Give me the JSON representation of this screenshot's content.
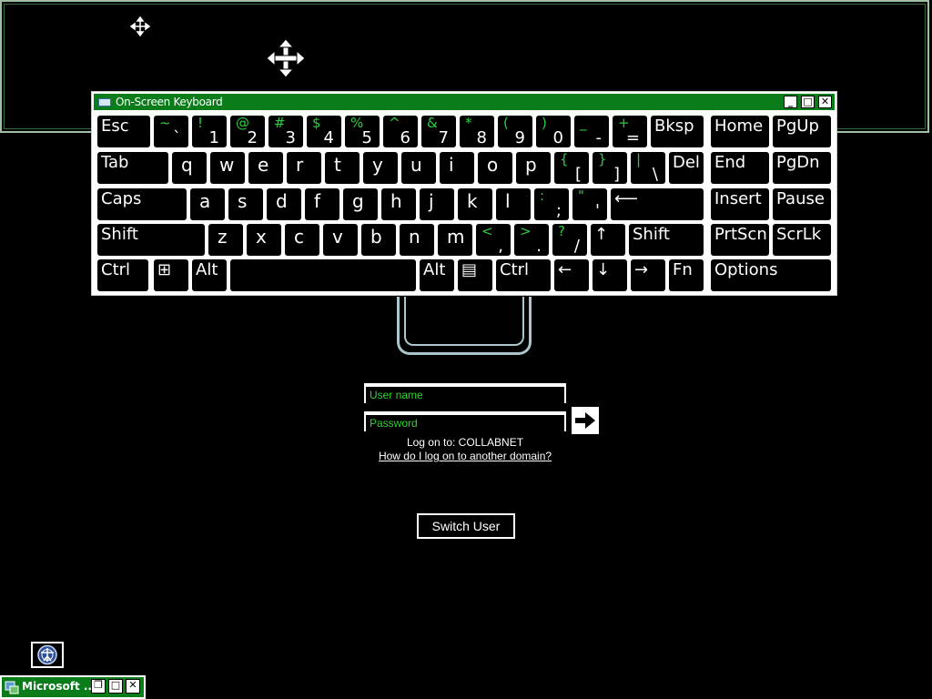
{
  "osk": {
    "title": "On-Screen Keyboard",
    "minimize": "_",
    "maximize": "□",
    "close": "✕",
    "rows": [
      [
        {
          "id": "esc",
          "label": "Esc"
        },
        {
          "id": "backtick",
          "shift": "~",
          "base": "`"
        },
        {
          "id": "1",
          "shift": "!",
          "base": "1"
        },
        {
          "id": "2",
          "shift": "@",
          "base": "2"
        },
        {
          "id": "3",
          "shift": "#",
          "base": "3"
        },
        {
          "id": "4",
          "shift": "$",
          "base": "4"
        },
        {
          "id": "5",
          "shift": "%",
          "base": "5"
        },
        {
          "id": "6",
          "shift": "^",
          "base": "6"
        },
        {
          "id": "7",
          "shift": "&",
          "base": "7"
        },
        {
          "id": "8",
          "shift": "*",
          "base": "8"
        },
        {
          "id": "9",
          "shift": "(",
          "base": "9"
        },
        {
          "id": "0",
          "shift": ")",
          "base": "0"
        },
        {
          "id": "minus",
          "shift": "_",
          "base": "-"
        },
        {
          "id": "equals",
          "shift": "+",
          "base": "="
        },
        {
          "id": "bksp",
          "label": "Bksp"
        },
        {
          "id": "home",
          "label": "Home"
        },
        {
          "id": "pgup",
          "label": "PgUp"
        }
      ],
      [
        {
          "id": "tab",
          "label": "Tab"
        },
        {
          "id": "q",
          "letter": "q"
        },
        {
          "id": "w",
          "letter": "w"
        },
        {
          "id": "e",
          "letter": "e"
        },
        {
          "id": "r",
          "letter": "r"
        },
        {
          "id": "t",
          "letter": "t"
        },
        {
          "id": "y",
          "letter": "y"
        },
        {
          "id": "u",
          "letter": "u"
        },
        {
          "id": "i",
          "letter": "i"
        },
        {
          "id": "o",
          "letter": "o"
        },
        {
          "id": "p",
          "letter": "p"
        },
        {
          "id": "lbracket",
          "shift": "{",
          "base": "["
        },
        {
          "id": "rbracket",
          "shift": "}",
          "base": "]"
        },
        {
          "id": "backslash",
          "shift": "|",
          "base": "\\"
        },
        {
          "id": "del",
          "label": "Del"
        },
        {
          "id": "end",
          "label": "End"
        },
        {
          "id": "pgdn",
          "label": "PgDn"
        }
      ],
      [
        {
          "id": "caps",
          "label": "Caps"
        },
        {
          "id": "a",
          "letter": "a"
        },
        {
          "id": "s",
          "letter": "s"
        },
        {
          "id": "d",
          "letter": "d"
        },
        {
          "id": "f",
          "letter": "f"
        },
        {
          "id": "g",
          "letter": "g"
        },
        {
          "id": "h",
          "letter": "h"
        },
        {
          "id": "j",
          "letter": "j"
        },
        {
          "id": "k",
          "letter": "k"
        },
        {
          "id": "l",
          "letter": "l"
        },
        {
          "id": "semicolon",
          "shift": ":",
          "base": ";"
        },
        {
          "id": "quote",
          "shift": "\"",
          "base": "'"
        },
        {
          "id": "enter",
          "label": "⟵"
        },
        {
          "id": "insert",
          "label": "Insert"
        },
        {
          "id": "pause",
          "label": "Pause"
        }
      ],
      [
        {
          "id": "lshift",
          "label": "Shift"
        },
        {
          "id": "z",
          "letter": "z"
        },
        {
          "id": "x",
          "letter": "x"
        },
        {
          "id": "c",
          "letter": "c"
        },
        {
          "id": "v",
          "letter": "v"
        },
        {
          "id": "b",
          "letter": "b"
        },
        {
          "id": "n",
          "letter": "n"
        },
        {
          "id": "m",
          "letter": "m"
        },
        {
          "id": "comma",
          "shift": "<",
          "base": ","
        },
        {
          "id": "period",
          "shift": ">",
          "base": "."
        },
        {
          "id": "slash",
          "shift": "?",
          "base": "/"
        },
        {
          "id": "up",
          "label": "↑"
        },
        {
          "id": "rshift",
          "label": "Shift"
        },
        {
          "id": "prtscn",
          "label": "PrtScn"
        },
        {
          "id": "scrlk",
          "label": "ScrLk"
        }
      ],
      [
        {
          "id": "lctrl",
          "label": "Ctrl"
        },
        {
          "id": "win",
          "label": "⊞"
        },
        {
          "id": "lalt",
          "label": "Alt"
        },
        {
          "id": "space",
          "label": ""
        },
        {
          "id": "ralt",
          "label": "Alt"
        },
        {
          "id": "menu",
          "label": "▤"
        },
        {
          "id": "rctrl",
          "label": "Ctrl"
        },
        {
          "id": "left",
          "label": "←"
        },
        {
          "id": "down",
          "label": "↓"
        },
        {
          "id": "right",
          "label": "→"
        },
        {
          "id": "fn",
          "label": "Fn"
        },
        {
          "id": "options",
          "label": "Options"
        }
      ]
    ]
  },
  "login": {
    "username_placeholder": "User name",
    "password_placeholder": "Password",
    "logon_to": "Log on to: COLLABNET",
    "other_domain_link": "How do I log on to another domain?",
    "switch_user": "Switch User"
  },
  "taskbar": {
    "item_label": "Microsoft ..."
  },
  "icons": {
    "move": "move-cursor-icon",
    "accessibility": "accessibility-icon",
    "submit": "arrow-right-icon"
  }
}
